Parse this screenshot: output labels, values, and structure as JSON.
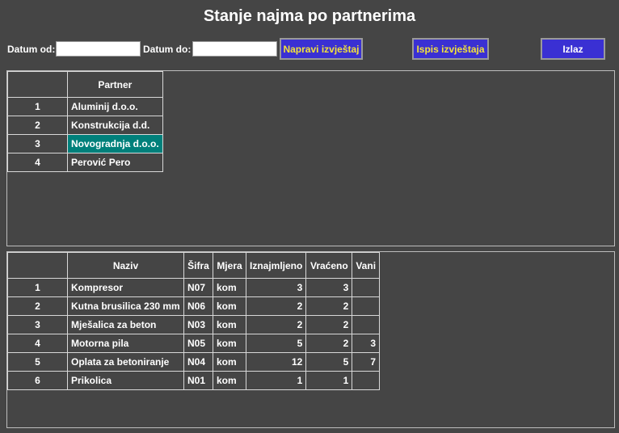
{
  "title": "Stanje najma po partnerima",
  "filters": {
    "date_from_label": "Datum od:",
    "date_from_value": "",
    "date_to_label": "Datum do:",
    "date_to_value": ""
  },
  "buttons": {
    "make_report": "Napravi izvještaj",
    "print_report": "Ispis izvještaja",
    "exit": "Izlaz"
  },
  "partners": {
    "header": "Partner",
    "rows": [
      {
        "num": "1",
        "name": "Aluminij d.o.o."
      },
      {
        "num": "2",
        "name": "Konstrukcija d.d."
      },
      {
        "num": "3",
        "name": "Novogradnja d.o.o."
      },
      {
        "num": "4",
        "name": "Perović Pero"
      }
    ],
    "selected_index": 2
  },
  "items": {
    "headers": [
      "Naziv",
      "Šifra",
      "Mjera",
      "Iznajmljeno",
      "Vraćeno",
      "Vani"
    ],
    "rows": [
      {
        "num": "1",
        "naziv": "Kompresor",
        "sifra": "N07",
        "mjera": "kom",
        "iznajmljeno": "3",
        "vraceno": "3",
        "vani": ""
      },
      {
        "num": "2",
        "naziv": "Kutna brusilica 230 mm",
        "sifra": "N06",
        "mjera": "kom",
        "iznajmljeno": "2",
        "vraceno": "2",
        "vani": ""
      },
      {
        "num": "3",
        "naziv": "Mješalica za beton",
        "sifra": "N03",
        "mjera": "kom",
        "iznajmljeno": "2",
        "vraceno": "2",
        "vani": ""
      },
      {
        "num": "4",
        "naziv": "Motorna pila",
        "sifra": "N05",
        "mjera": "kom",
        "iznajmljeno": "5",
        "vraceno": "2",
        "vani": "3"
      },
      {
        "num": "5",
        "naziv": "Oplata za betoniranje",
        "sifra": "N04",
        "mjera": "kom",
        "iznajmljeno": "12",
        "vraceno": "5",
        "vani": "7"
      },
      {
        "num": "6",
        "naziv": "Prikolica",
        "sifra": "N01",
        "mjera": "kom",
        "iznajmljeno": "1",
        "vraceno": "1",
        "vani": ""
      }
    ]
  },
  "colors": {
    "background": "#454545",
    "button_bg": "#3a30d3",
    "button_text": "#f3e23a",
    "selection": "#00807b"
  }
}
